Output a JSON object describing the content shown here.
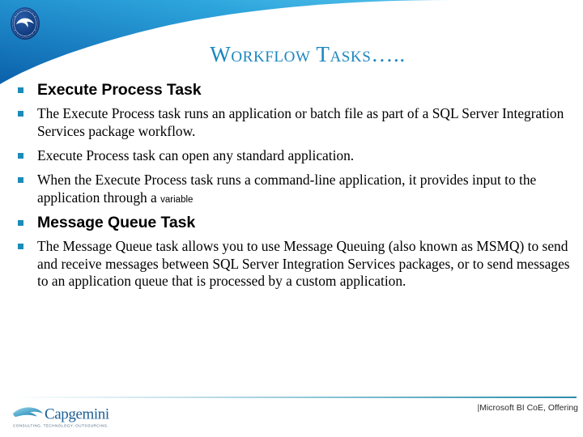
{
  "slide": {
    "title": "Workflow Tasks…..",
    "accent_color": "#1b87bf",
    "bullet_color": "#1b8cb8",
    "background_color": "#ffffff",
    "header_gradient_from": "#2ea8dd",
    "header_gradient_to": "#0c5fa6"
  },
  "logos": {
    "seal": {
      "name": "circular-seal-emblem",
      "ring_text_top": "INFORMATION",
      "ring_text_bottom": "CENTER OF EXCELLENCE"
    },
    "capgemini": {
      "wordmark": "Capgemini",
      "tagline": "CONSULTING. TECHNOLOGY. OUTSOURCING."
    }
  },
  "content": {
    "bullets": [
      {
        "level": "head",
        "text": "Execute Process Task"
      },
      {
        "level": "body",
        "text": "The Execute Process task runs an application or batch file as part of a SQL Server Integration Services package workflow."
      },
      {
        "level": "body",
        "text": "Execute Process task can open any standard application."
      },
      {
        "level": "body",
        "text": "When the Execute Process task runs a command-line application, it provides input to the application through a ",
        "small_tail": "variable"
      },
      {
        "level": "head",
        "text": "Message Queue Task"
      },
      {
        "level": "body",
        "text": "The Message Queue task allows you to use Message Queuing (also known as MSMQ) to send and receive messages between SQL Server Integration Services packages, or to send messages to an application queue that is processed by a custom application."
      }
    ]
  },
  "footer": {
    "note": "|Microsoft BI CoE, Offering"
  }
}
